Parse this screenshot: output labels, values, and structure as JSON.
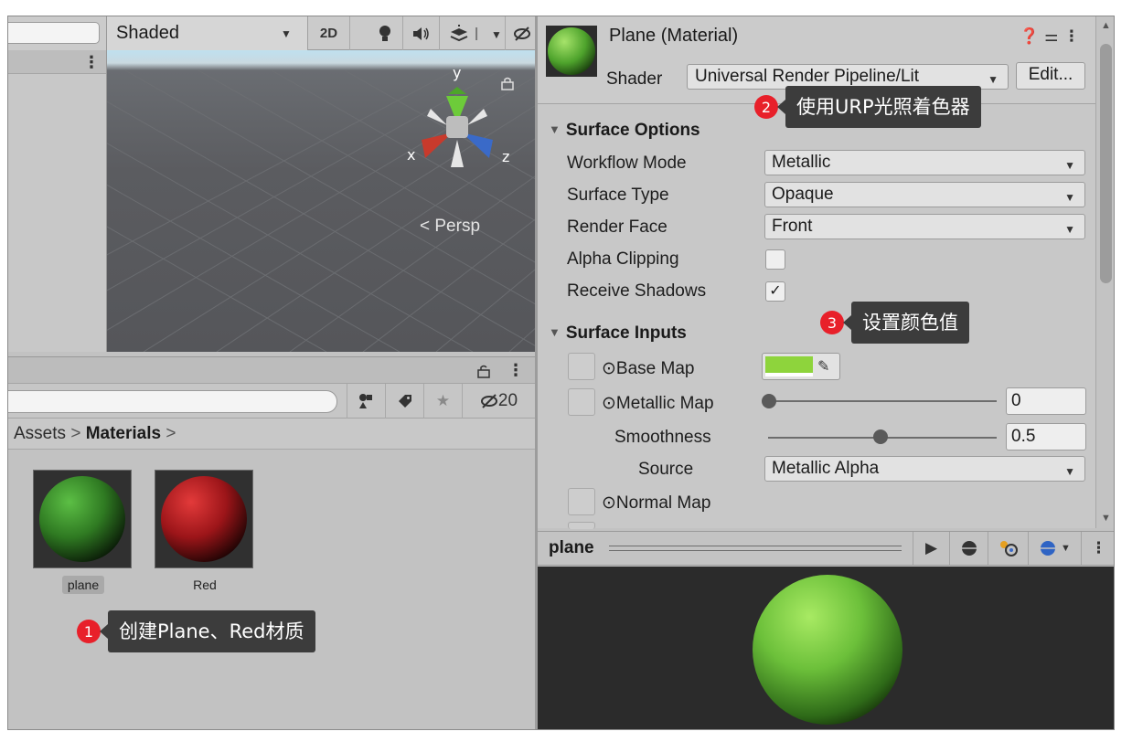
{
  "scene": {
    "shading_mode": "Shaded",
    "mode_2d": "2D",
    "persp_label": "< Persp",
    "gizmo": {
      "y": "y",
      "x": "x",
      "z": "z"
    }
  },
  "project": {
    "hidden_count": "20",
    "breadcrumb": {
      "root": "Assets",
      "sep": ">",
      "current": "Materials"
    },
    "assets": [
      {
        "name": "plane",
        "color": "#3f9a2c"
      },
      {
        "name": "Red",
        "color": "#b31d22"
      }
    ]
  },
  "inspector": {
    "title": "Plane (Material)",
    "shader_label": "Shader",
    "shader_value": "Universal Render Pipeline/Lit",
    "edit_label": "Edit...",
    "surface_options": {
      "header": "Surface Options",
      "workflow_mode": {
        "label": "Workflow Mode",
        "value": "Metallic"
      },
      "surface_type": {
        "label": "Surface Type",
        "value": "Opaque"
      },
      "render_face": {
        "label": "Render Face",
        "value": "Front"
      },
      "alpha_clipping": {
        "label": "Alpha Clipping",
        "checked": false
      },
      "receive_shadows": {
        "label": "Receive Shadows",
        "checked": true,
        "check_glyph": "✓"
      }
    },
    "surface_inputs": {
      "header": "Surface Inputs",
      "base_map": {
        "label": "⊙Base Map",
        "color": "#8ed43c"
      },
      "metallic_map": {
        "label": "⊙Metallic Map",
        "value": "0",
        "fraction": 0.0
      },
      "smoothness": {
        "label": "Smoothness",
        "value": "0.5",
        "fraction": 0.5
      },
      "source": {
        "label": "Source",
        "value": "Metallic Alpha"
      },
      "normal_map": {
        "label": "⊙Normal Map"
      }
    }
  },
  "preview": {
    "label": "plane"
  },
  "callouts": [
    {
      "number": "1",
      "text": "创建Plane、Red材质"
    },
    {
      "number": "2",
      "text": "使用URP光照着色器"
    },
    {
      "number": "3",
      "text": "设置颜色值"
    }
  ],
  "colors": {
    "callout_badge": "#e8202a",
    "callout_bg": "#3c3c3c",
    "material_green": "#8ed43c"
  }
}
